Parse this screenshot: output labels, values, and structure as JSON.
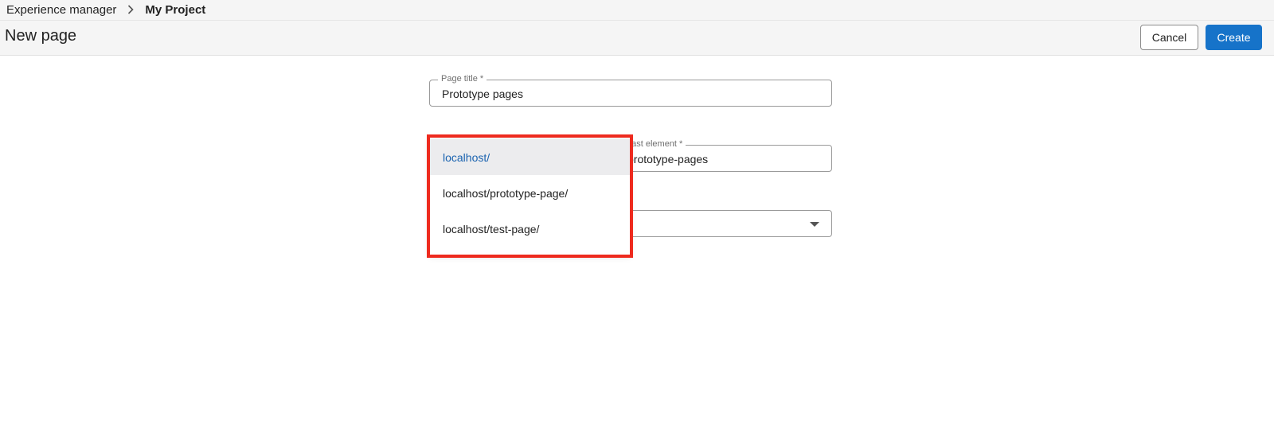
{
  "breadcrumb": {
    "root": "Experience manager",
    "separator_icon": "chevron-right-icon",
    "current": "My Project"
  },
  "header": {
    "title": "New page",
    "cancel_label": "Cancel",
    "create_label": "Create"
  },
  "form": {
    "page_title": {
      "label": "Page title *",
      "value": "Prototype pages"
    },
    "last_element": {
      "label": "Last element *",
      "value": "prototype-pages"
    },
    "parent_select": {
      "value": "",
      "caret_icon": "caret-down-icon"
    }
  },
  "dropdown": {
    "items": [
      {
        "label": "localhost/",
        "selected": true
      },
      {
        "label": "localhost/prototype-page/",
        "selected": false
      },
      {
        "label": "localhost/test-page/",
        "selected": false
      }
    ]
  },
  "colors": {
    "primary": "#1673c9",
    "highlight": "#ee2a1e",
    "selected_text": "#1a63b0",
    "selected_bg": "#ececee"
  }
}
